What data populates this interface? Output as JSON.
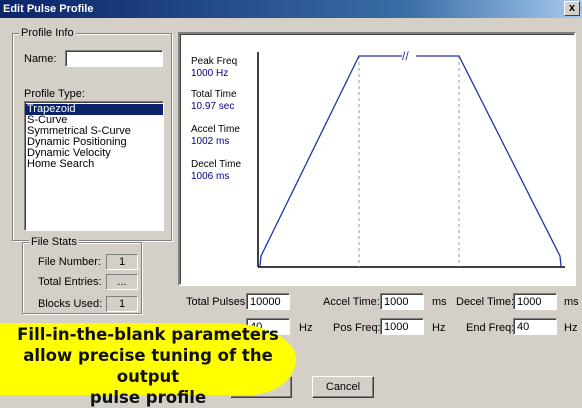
{
  "window": {
    "title": "Edit Pulse Profile",
    "close_glyph": "x"
  },
  "profile_info": {
    "group_label": "Profile Info",
    "name_label": "Name:",
    "name_value": "",
    "type_label": "Profile Type:",
    "types": [
      "Trapezoid",
      "S-Curve",
      "Symmetrical S-Curve",
      "Dynamic Positioning",
      "Dynamic Velocity",
      "Home Search"
    ],
    "selected_type": "Trapezoid"
  },
  "file_stats": {
    "group_label": "File Stats",
    "file_number_label": "File Number:",
    "file_number": "1",
    "total_entries_label": "Total Entries:",
    "total_entries": "...",
    "blocks_used_label": "Blocks Used:",
    "blocks_used": "1"
  },
  "plot": {
    "peak_freq_label": "Peak Freq",
    "peak_freq_value": "1000 Hz",
    "total_time_label": "Total Time",
    "total_time_value": "10.97 sec",
    "accel_time_label": "Accel Time",
    "accel_time_value": "1002 ms",
    "decel_time_label": "Decel Time",
    "decel_time_value": "1006 ms",
    "break_mark": "//"
  },
  "params": {
    "total_pulses_label": "Total Pulses:",
    "total_pulses": "10000",
    "accel_time_label": "Accel Time:",
    "accel_time": "1000",
    "accel_unit": "ms",
    "decel_time_label": "Decel Time:",
    "decel_time": "1000",
    "decel_unit": "ms",
    "start_freq": "40",
    "start_unit": "Hz",
    "pos_freq_label": "Pos Freq:",
    "pos_freq": "1000",
    "pos_unit": "Hz",
    "end_freq_label": "End Freq:",
    "end_freq": "40",
    "end_unit": "Hz"
  },
  "buttons": {
    "cancel": "Cancel"
  },
  "callout": {
    "line1": "Fill-in-the-blank parameters",
    "line2": "allow precise tuning of the output",
    "line3": "pulse profile"
  },
  "colors": {
    "title_bar": "#0a246a",
    "callout": "#ffff00",
    "curve": "#1f35a8",
    "value_text": "#00008b"
  }
}
